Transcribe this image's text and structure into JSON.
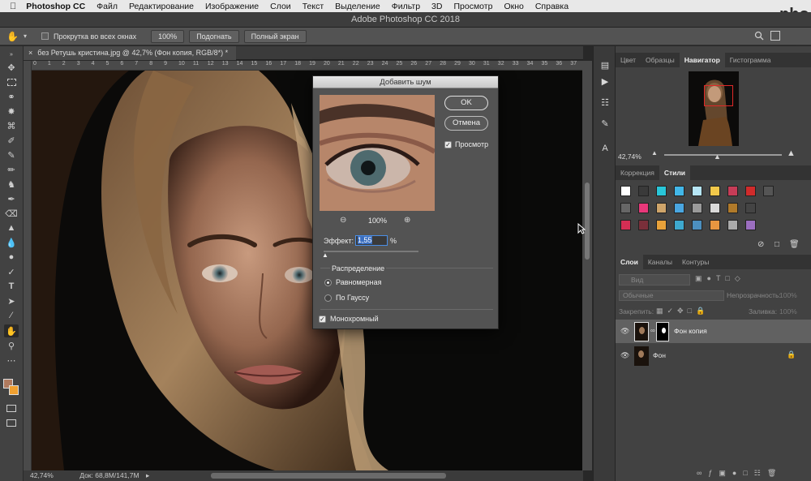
{
  "menubar": {
    "app": "Photoshop CC",
    "items": [
      "Файл",
      "Редактирование",
      "Изображение",
      "Слои",
      "Текст",
      "Выделение",
      "Фильтр",
      "3D",
      "Просмотр",
      "Окно",
      "Справка"
    ]
  },
  "window_title": "Adobe Photoshop CC 2018",
  "options_bar": {
    "scroll_all_label": "Прокрутка во всех окнах",
    "zoom_100": "100%",
    "fit_label": "Подогнать",
    "fullscreen_label": "Полный экран"
  },
  "document": {
    "tab_label": "без Ретушь кристина.jpg @ 42,7% (Фон копия, RGB/8*) *",
    "ruler_ticks": [
      "0",
      "1",
      "2",
      "3",
      "4",
      "5",
      "6",
      "7",
      "8",
      "9",
      "10",
      "11",
      "12",
      "13",
      "14",
      "15",
      "16",
      "17",
      "18",
      "19",
      "20",
      "21",
      "22",
      "23",
      "24",
      "25",
      "26",
      "27",
      "28",
      "29",
      "30",
      "31",
      "32",
      "33",
      "34",
      "35",
      "36",
      "37"
    ]
  },
  "status_bar": {
    "zoom": "42,74%",
    "doc_size": "Док: 68,8M/141,7M"
  },
  "dialog": {
    "title": "Добавить шум",
    "ok": "OK",
    "cancel": "Отмена",
    "preview_label": "Просмотр",
    "preview_checked": true,
    "preview_zoom": "100%",
    "amount_label": "Эффект:",
    "amount_value": "1,55",
    "amount_unit": "%",
    "distribution_label": "Распределение",
    "uniform_label": "Равномерная",
    "gaussian_label": "По Гауссу",
    "selected_distribution": "uniform",
    "mono_label": "Монохромный",
    "mono_checked": true
  },
  "panels": {
    "top_tabs": [
      "Цвет",
      "Образцы",
      "Навигатор",
      "Гистограмма"
    ],
    "top_active": "Навигатор",
    "navigator_zoom": "42,74%",
    "mid_tabs": [
      "Коррекция",
      "Стили"
    ],
    "mid_active": "Стили",
    "layers_tabs": [
      "Слои",
      "Каналы",
      "Контуры"
    ],
    "layers_active": "Слои",
    "kind_filter": "Вид",
    "blend_mode": "Обычные",
    "opacity_label": "Непрозрачность:",
    "opacity_value": "100%",
    "lock_label": "Закрепить:",
    "fill_label": "Заливка:",
    "fill_value": "100%",
    "layers": [
      {
        "name": "Фон копия",
        "selected": true
      },
      {
        "name": "Фон",
        "selected": false
      }
    ]
  },
  "style_swatches": [
    "#ffffff",
    "#3a3a3a",
    "#29c6d8",
    "#42b7e8",
    "#b6e5f5",
    "#f2c84a",
    "#c63c57",
    "#d02b2b",
    "#555555",
    "#666666",
    "#e8387a",
    "#cfa56a",
    "#4aa6e0",
    "#9a9a9a",
    "#d9d9d9",
    "#b07a2a",
    "#444444",
    "#d42e54",
    "#7a2f3a",
    "#e8a23a",
    "#3ea9cf",
    "#4c8fbf",
    "#e89640",
    "#aaaaaa",
    "#9b6ec0"
  ],
  "watermark": "Photoshop-Master"
}
